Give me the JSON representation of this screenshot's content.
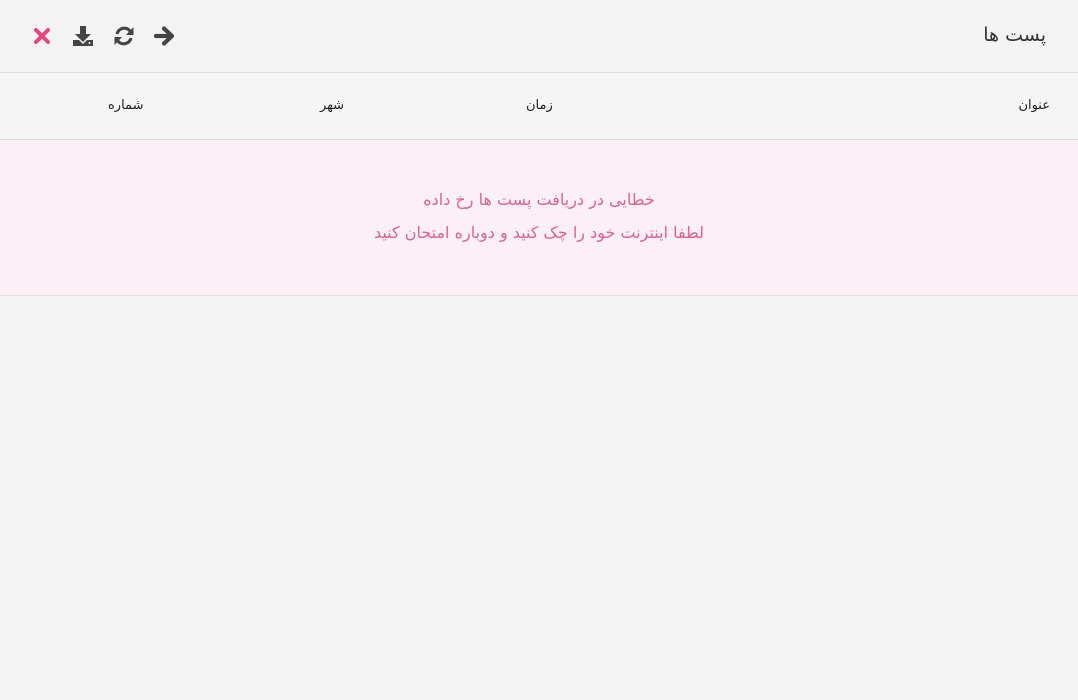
{
  "header": {
    "title": "پست ها",
    "toolbar": {
      "close_icon": "close-icon",
      "download_icon": "download-icon",
      "refresh_icon": "refresh-icon",
      "forward_icon": "arrow-right-icon"
    }
  },
  "table": {
    "columns": [
      {
        "key": "title",
        "label": "عنوان"
      },
      {
        "key": "time",
        "label": "زمان"
      },
      {
        "key": "city",
        "label": "شهر"
      },
      {
        "key": "number",
        "label": "شماره"
      }
    ]
  },
  "error": {
    "line1": "خطایی در دریافت پست ها رخ داده",
    "line2": "لطفا اینترنت خود را چک کنید و دوباره امتحان کنید"
  },
  "colors": {
    "background": "#f3f3f3",
    "icon_dark": "#444444",
    "close_accent": "#e8457a",
    "error_text": "#e0638f",
    "error_background": "#fbf0f6"
  }
}
